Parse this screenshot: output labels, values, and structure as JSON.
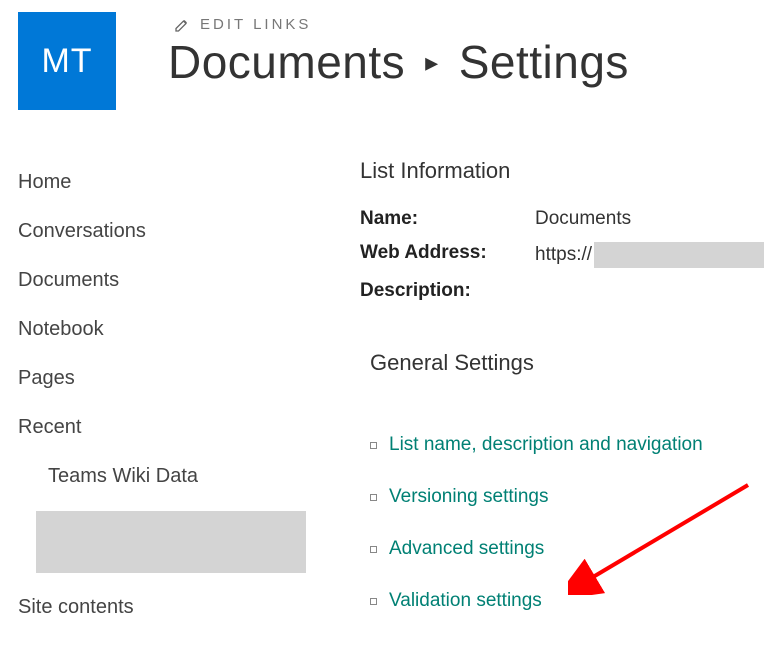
{
  "header": {
    "site_logo_text": "MT",
    "edit_links_label": "EDIT LINKS",
    "breadcrumb_library": "Documents",
    "breadcrumb_page": "Settings"
  },
  "sidebar": {
    "items": [
      {
        "label": "Home"
      },
      {
        "label": "Conversations"
      },
      {
        "label": "Documents"
      },
      {
        "label": "Notebook"
      },
      {
        "label": "Pages"
      },
      {
        "label": "Recent"
      }
    ],
    "recent_sub": {
      "label": "Teams Wiki Data"
    },
    "site_contents_label": "Site contents"
  },
  "main": {
    "list_info_heading": "List Information",
    "name_label": "Name:",
    "name_value": "Documents",
    "web_address_label": "Web Address:",
    "web_address_prefix": "https://",
    "description_label": "Description:",
    "general_settings_heading": "General Settings",
    "settings_links": [
      {
        "label": "List name, description and navigation"
      },
      {
        "label": "Versioning settings"
      },
      {
        "label": "Advanced settings"
      },
      {
        "label": "Validation settings"
      }
    ]
  }
}
